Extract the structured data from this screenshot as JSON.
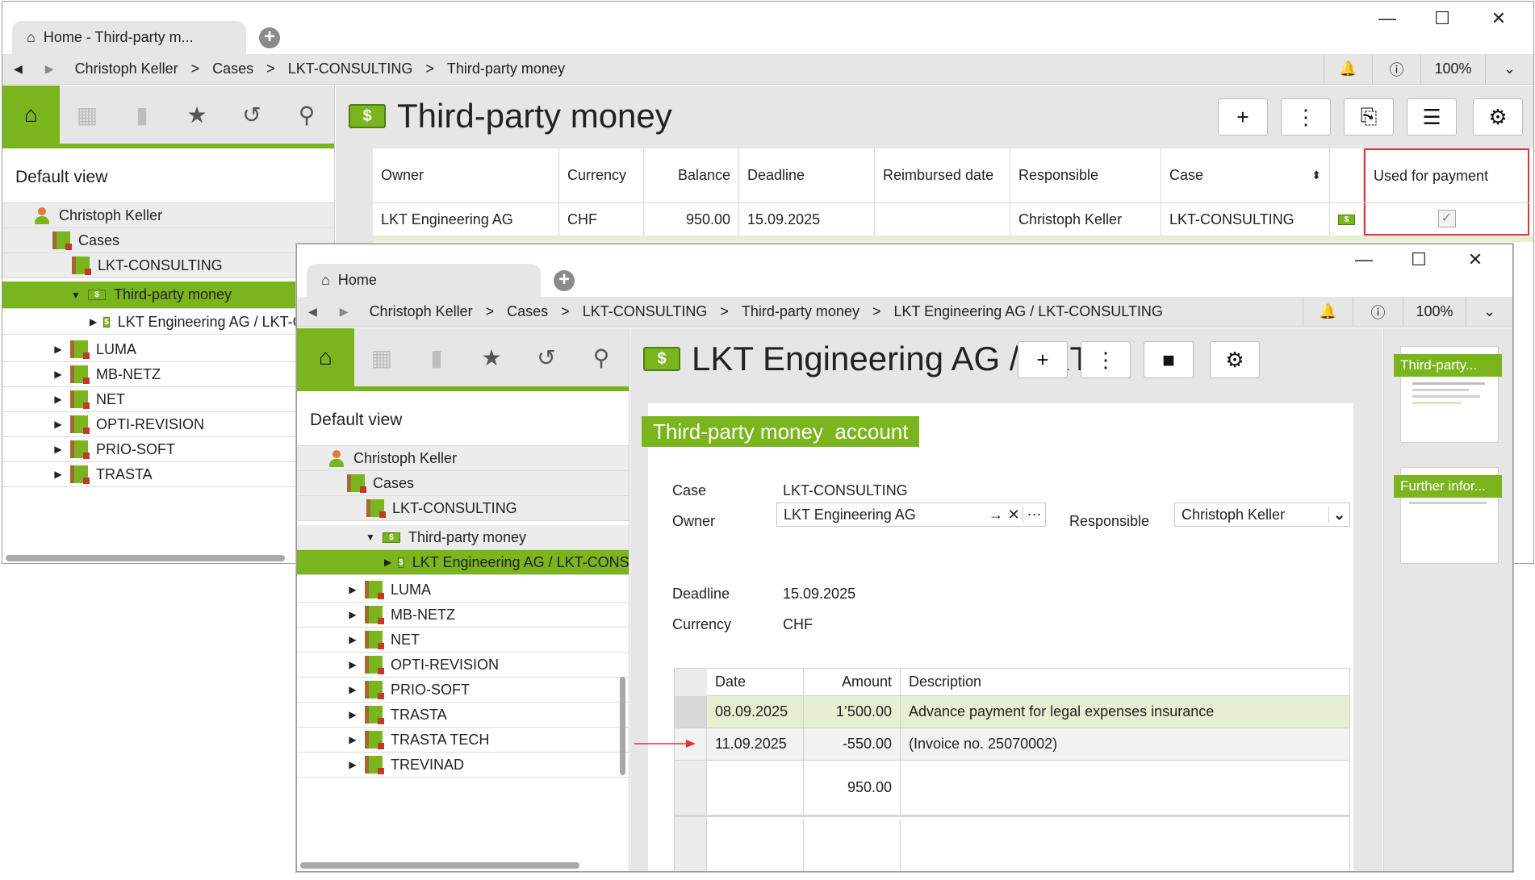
{
  "back_window": {
    "tab_title": "Home - Third-party m...",
    "breadcrumb": [
      "Christoph Keller",
      "Cases",
      "LKT-CONSULTING",
      "Third-party money"
    ],
    "zoom": "100%",
    "sidebar": {
      "default_view": "Default view",
      "tree": [
        {
          "label": "Christoph Keller",
          "icon": "person-icon"
        },
        {
          "label": "Cases",
          "icon": "folder-icon"
        },
        {
          "label": "LKT-CONSULTING",
          "icon": "folder-icon"
        },
        {
          "label": "Third-party money",
          "icon": "money-icon"
        },
        {
          "label": "LKT Engineering AG / LKT-CONSULTING",
          "icon": "money-icon"
        },
        {
          "label": "LUMA",
          "icon": "folder-icon"
        },
        {
          "label": "MB-NETZ",
          "icon": "folder-icon"
        },
        {
          "label": "NET",
          "icon": "folder-icon"
        },
        {
          "label": "OPTI-REVISION",
          "icon": "folder-icon"
        },
        {
          "label": "PRIO-SOFT",
          "icon": "folder-icon"
        },
        {
          "label": "TRASTA",
          "icon": "folder-icon"
        }
      ]
    },
    "page_title": "Third-party money",
    "table": {
      "columns": [
        "Owner",
        "Currency",
        "Balance",
        "Deadline",
        "Reimbursed date",
        "Responsible",
        "Case",
        "",
        "Used for payment"
      ],
      "rows": [
        {
          "owner": "LKT Engineering AG",
          "currency": "CHF",
          "balance": "950.00",
          "deadline": "15.09.2025",
          "reimbursed": "",
          "responsible": "Christoph Keller",
          "case": "LKT-CONSULTING",
          "used_for_payment": true
        }
      ]
    },
    "highlight_color": "#e0323c"
  },
  "front_window": {
    "tab_title": "Home",
    "breadcrumb": [
      "Christoph Keller",
      "Cases",
      "LKT-CONSULTING",
      "Third-party money",
      "LKT Engineering AG / LKT-CONSULTING"
    ],
    "zoom": "100%",
    "sidebar": {
      "default_view": "Default view",
      "tree": [
        {
          "label": "Christoph Keller",
          "icon": "person-icon"
        },
        {
          "label": "Cases",
          "icon": "folder-icon"
        },
        {
          "label": "LKT-CONSULTING",
          "icon": "folder-icon"
        },
        {
          "label": "Third-party money",
          "icon": "money-icon"
        },
        {
          "label": "LKT Engineering AG / LKT-CONSULTING",
          "icon": "money-icon"
        },
        {
          "label": "LUMA",
          "icon": "folder-icon"
        },
        {
          "label": "MB-NETZ",
          "icon": "folder-icon"
        },
        {
          "label": "NET",
          "icon": "folder-icon"
        },
        {
          "label": "OPTI-REVISION",
          "icon": "folder-icon"
        },
        {
          "label": "PRIO-SOFT",
          "icon": "folder-icon"
        },
        {
          "label": "TRASTA",
          "icon": "folder-icon"
        },
        {
          "label": "TRASTA TECH",
          "icon": "folder-icon"
        },
        {
          "label": "TREVINAD",
          "icon": "folder-icon"
        }
      ]
    },
    "page_title": "LKT Engineering AG / LKT...",
    "section_title": "Third-party money  account",
    "form": {
      "case_label": "Case",
      "case_value": "LKT-CONSULTING",
      "owner_label": "Owner",
      "owner_value": "LKT Engineering AG",
      "responsible_label": "Responsible",
      "responsible_value": "Christoph Keller",
      "deadline_label": "Deadline",
      "deadline_value": "15.09.2025",
      "currency_label": "Currency",
      "currency_value": "CHF"
    },
    "transactions": {
      "columns": [
        "Date",
        "Amount",
        "Description"
      ],
      "rows": [
        {
          "date": "08.09.2025",
          "amount": "1’500.00",
          "description": "Advance payment for legal expenses insurance"
        },
        {
          "date": "11.09.2025",
          "amount": "-550.00",
          "description": "(Invoice no. 25070002)"
        }
      ],
      "total": "950.00"
    },
    "thumbnails": [
      "Third-party...",
      "Further infor..."
    ]
  },
  "colors": {
    "accent_green": "#7ab51d",
    "row_highlight": "#e6efd2",
    "arrow_red": "#e0323c"
  }
}
